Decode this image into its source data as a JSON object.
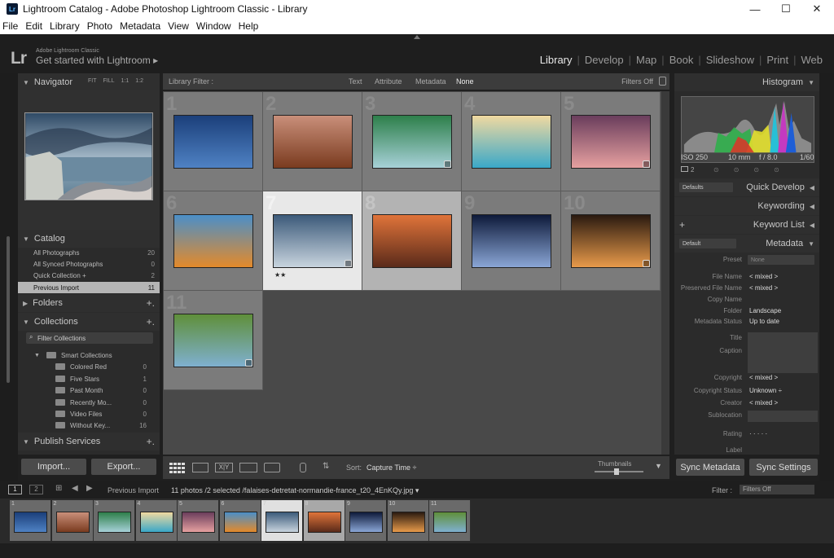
{
  "window": {
    "title": "Lightroom Catalog - Adobe Photoshop Lightroom Classic - Library",
    "app_icon": "Lr"
  },
  "menu": [
    "File",
    "Edit",
    "Library",
    "Photo",
    "Metadata",
    "View",
    "Window",
    "Help"
  ],
  "identity": {
    "logo": "Lr",
    "small": "Adobe Lightroom Classic",
    "big": "Get started with Lightroom ▸"
  },
  "modules": [
    "Library",
    "Develop",
    "Map",
    "Book",
    "Slideshow",
    "Print",
    "Web"
  ],
  "navigator": {
    "title": "Navigator",
    "modes": [
      "FIT",
      "FILL",
      "1:1",
      "1:2"
    ]
  },
  "catalog": {
    "title": "Catalog",
    "items": [
      {
        "label": "All Photographs",
        "count": "20"
      },
      {
        "label": "All Synced Photographs",
        "count": "0"
      },
      {
        "label": "Quick Collection +",
        "count": "2"
      },
      {
        "label": "Previous Import",
        "count": "11"
      }
    ]
  },
  "folders": {
    "title": "Folders"
  },
  "collections": {
    "title": "Collections",
    "filter": "Filter Collections",
    "group": "Smart Collections",
    "items": [
      {
        "label": "Colored Red",
        "count": "0"
      },
      {
        "label": "Five Stars",
        "count": "1"
      },
      {
        "label": "Past Month",
        "count": "0"
      },
      {
        "label": "Recently Mo...",
        "count": "0"
      },
      {
        "label": "Video Files",
        "count": "0"
      },
      {
        "label": "Without Key...",
        "count": "16"
      }
    ]
  },
  "publish": {
    "title": "Publish Services"
  },
  "left_buttons": {
    "import": "Import...",
    "export": "Export..."
  },
  "filterbar": {
    "label": "Library Filter :",
    "options": [
      "Text",
      "Attribute",
      "Metadata",
      "None"
    ],
    "status": "Filters Off"
  },
  "grid": {
    "cells": [
      {
        "num": "1",
        "colors": [
          "#1b3f7a",
          "#4f82c4"
        ]
      },
      {
        "num": "2",
        "colors": [
          "#c98f7a",
          "#7a3b1f"
        ]
      },
      {
        "num": "3",
        "colors": [
          "#2d7f4a",
          "#a7d1d8"
        ]
      },
      {
        "num": "4",
        "colors": [
          "#f0d9a0",
          "#3aa8c8"
        ]
      },
      {
        "num": "5",
        "colors": [
          "#6a3d5c",
          "#e6a0a0"
        ]
      },
      {
        "num": "6",
        "colors": [
          "#4b8fc8",
          "#e48a2a"
        ]
      },
      {
        "num": "7",
        "colors": [
          "#3c5a7a",
          "#c8d4de"
        ],
        "stars": "★★"
      },
      {
        "num": "8",
        "colors": [
          "#e0743a",
          "#5a2a1a"
        ]
      },
      {
        "num": "9",
        "colors": [
          "#0e1a3a",
          "#8aa6d6"
        ]
      },
      {
        "num": "10",
        "colors": [
          "#2a1a10",
          "#e89a4a"
        ]
      },
      {
        "num": "11",
        "colors": [
          "#5f8f3a",
          "#7fb0d0"
        ]
      }
    ]
  },
  "toolbar": {
    "sort_label": "Sort:",
    "sort_value": "Capture Time ÷",
    "thumbnails": "Thumbnails"
  },
  "histogram": {
    "title": "Histogram",
    "iso": "ISO 250",
    "focal": "10 mm",
    "aperture": "f / 8.0",
    "shutter": "1/60",
    "count": "2"
  },
  "quick_develop": {
    "preset": "Defaults",
    "title": "Quick Develop"
  },
  "keywording": {
    "title": "Keywording"
  },
  "keyword_list": {
    "title": "Keyword List"
  },
  "metadata": {
    "preset_small": "Default",
    "title": "Metadata",
    "preset_label": "Preset",
    "preset_value": "None",
    "rows": [
      {
        "k": "File Name",
        "v": "< mixed >"
      },
      {
        "k": "Preserved File Name",
        "v": "< mixed >"
      },
      {
        "k": "Copy Name",
        "v": ""
      },
      {
        "k": "Folder",
        "v": "Landscape"
      },
      {
        "k": "Metadata Status",
        "v": "Up to date"
      },
      {
        "k": "Title",
        "v": ""
      },
      {
        "k": "Caption",
        "v": ""
      },
      {
        "k": "Copyright",
        "v": "< mixed >"
      },
      {
        "k": "Copyright Status",
        "v": "Unknown ÷"
      },
      {
        "k": "Creator",
        "v": "< mixed >"
      },
      {
        "k": "Sublocation",
        "v": ""
      },
      {
        "k": "Rating",
        "v": "·  ·  ·  ·  ·"
      },
      {
        "k": "Label",
        "v": ""
      }
    ]
  },
  "sync": {
    "metadata": "Sync Metadata",
    "settings": "Sync Settings"
  },
  "filmstrip": {
    "screens": [
      "1",
      "2"
    ],
    "source": "Previous Import",
    "info": "11 photos /2 selected /falaises-detretat-normandie-france_t20_4EnKQy.jpg ▾",
    "filter_label": "Filter :",
    "filter_value": "Filters Off"
  }
}
